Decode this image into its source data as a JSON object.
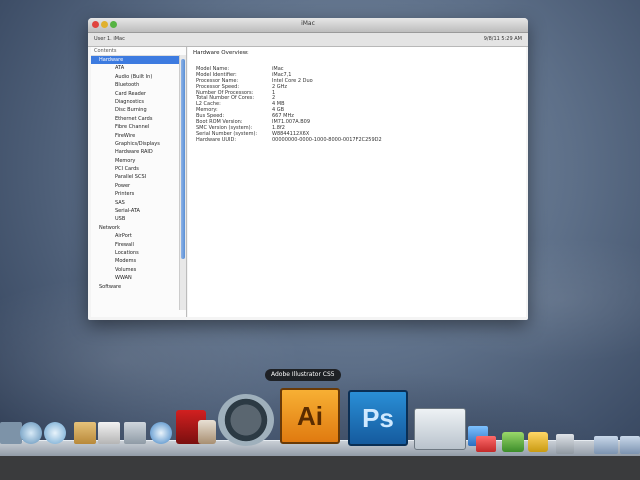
{
  "window": {
    "title": "iMac",
    "path": "User 1. iMac",
    "date": "9/8/11 5:29 AM"
  },
  "sidebar": {
    "header": "Contents",
    "items": [
      {
        "label": "Hardware",
        "type": "category",
        "selected": true
      },
      {
        "label": "ATA",
        "type": "item"
      },
      {
        "label": "Audio (Built In)",
        "type": "item"
      },
      {
        "label": "Bluetooth",
        "type": "item"
      },
      {
        "label": "Card Reader",
        "type": "item"
      },
      {
        "label": "Diagnostics",
        "type": "item"
      },
      {
        "label": "Disc Burning",
        "type": "item"
      },
      {
        "label": "Ethernet Cards",
        "type": "item"
      },
      {
        "label": "Fibre Channel",
        "type": "item"
      },
      {
        "label": "FireWire",
        "type": "item"
      },
      {
        "label": "Graphics/Displays",
        "type": "item"
      },
      {
        "label": "Hardware RAID",
        "type": "item"
      },
      {
        "label": "Memory",
        "type": "item"
      },
      {
        "label": "PCI Cards",
        "type": "item"
      },
      {
        "label": "Parallel SCSI",
        "type": "item"
      },
      {
        "label": "Power",
        "type": "item"
      },
      {
        "label": "Printers",
        "type": "item"
      },
      {
        "label": "SAS",
        "type": "item"
      },
      {
        "label": "Serial-ATA",
        "type": "item"
      },
      {
        "label": "USB",
        "type": "item"
      },
      {
        "label": "Network",
        "type": "category"
      },
      {
        "label": "AirPort",
        "type": "item"
      },
      {
        "label": "Firewall",
        "type": "item"
      },
      {
        "label": "Locations",
        "type": "item"
      },
      {
        "label": "Modems",
        "type": "item"
      },
      {
        "label": "Volumes",
        "type": "item"
      },
      {
        "label": "WWAN",
        "type": "item"
      },
      {
        "label": "Software",
        "type": "category"
      }
    ]
  },
  "content": {
    "header": "Hardware Overview:",
    "rows": [
      {
        "key": "Model Name:",
        "value": "iMac"
      },
      {
        "key": "Model Identifier:",
        "value": "iMac7,1"
      },
      {
        "key": "Processor Name:",
        "value": "Intel Core 2 Duo"
      },
      {
        "key": "Processor Speed:",
        "value": "2 GHz"
      },
      {
        "key": "Number Of Processors:",
        "value": "1"
      },
      {
        "key": "Total Number Of Cores:",
        "value": "2"
      },
      {
        "key": "L2 Cache:",
        "value": "4 MB"
      },
      {
        "key": "Memory:",
        "value": "4 GB"
      },
      {
        "key": "Bus Speed:",
        "value": "667 MHz"
      },
      {
        "key": "Boot ROM Version:",
        "value": "IM71.007A.B09"
      },
      {
        "key": "SMC Version (system):",
        "value": "1.8f2"
      },
      {
        "key": "Serial Number (system):",
        "value": "W8844112X6X"
      },
      {
        "key": "Hardware UUID:",
        "value": "00000000-0000-1000-8000-0017F2C259D2"
      }
    ]
  },
  "dock": {
    "tooltip": "Adobe Illustrator CS5",
    "ai_label": "Ai",
    "ps_label": "Ps"
  }
}
